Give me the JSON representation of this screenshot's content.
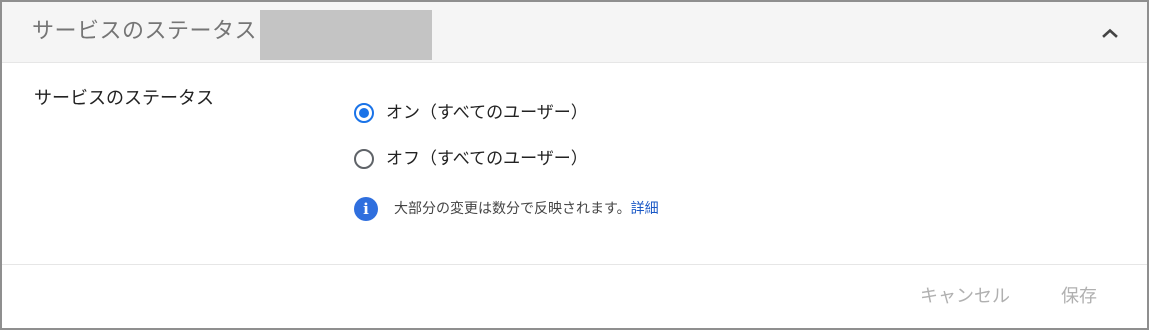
{
  "header": {
    "title": "サービスのステータス",
    "collapse_icon": "chevron-up-icon"
  },
  "setting": {
    "label": "サービスのステータス",
    "options": [
      {
        "label": "オン（すべてのユーザー）",
        "selected": true
      },
      {
        "label": "オフ（すべてのユーザー）",
        "selected": false
      }
    ],
    "info_icon": "info-icon",
    "info_text": "大部分の変更は数分で反映されます。",
    "info_link": "詳細"
  },
  "footer": {
    "cancel_label": "キャンセル",
    "save_label": "保存"
  },
  "colors": {
    "accent": "#1a73e8",
    "link": "#1a58c6",
    "disabled_text": "#b0b0b0",
    "header_bg": "#f5f5f5"
  }
}
